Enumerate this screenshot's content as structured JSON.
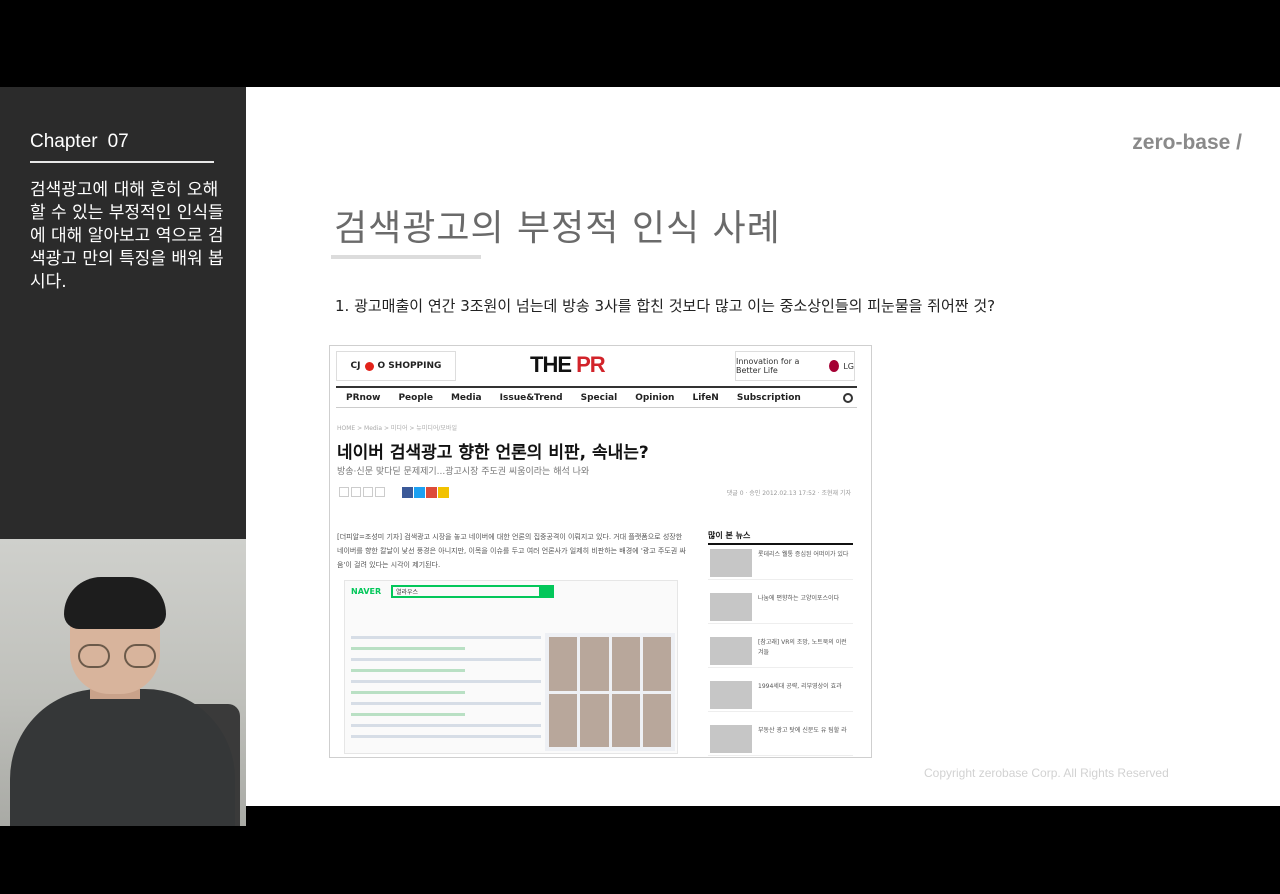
{
  "sidebar": {
    "chapter_label": "Chapter",
    "chapter_number": "07",
    "description": "검색광고에 대해 흔히 오해할 수 있는 부정적인 인식들에 대해 알아보고 역으로 검색광고 만의 특징을 배워 봅시다."
  },
  "slide": {
    "logo": "zero-base /",
    "title": "검색광고의 부정적 인식 사례",
    "point": "1. 광고매출이 연간 3조원이 넘는데 방송 3사를 합친 것보다 많고 이는 중소상인들의 피눈물을 쥐어짠 것?",
    "copyright": "Copyright zerobase Corp. All Rights Reserved"
  },
  "article": {
    "ad_left": "O SHOPPING",
    "ad_left_prefix": "CJ",
    "masthead_the": "THE ",
    "masthead_pr": "PR",
    "ad_right": "Innovation for a Better Life",
    "ad_right_brand": "LG",
    "nav": [
      "PRnow",
      "People",
      "Media",
      "Issue&Trend",
      "Special",
      "Opinion",
      "LifeN",
      "Subscription"
    ],
    "breadcrumb": "HOME > Media > 미디어 > 뉴미디어/모바일",
    "headline": "네이버 검색광고 향한 언론의 비판, 속내는?",
    "subheadline": "방송·신문 맞다딛 문제제기...광고시장 주도권 씨움이라는 해석 나와",
    "meta": "댓글 0 · 승인 2012.02.13 17:52 · 조현재 기자",
    "body": "[더피알=조성미 기자] 검색광고 시장을 놓고 네이버에 대한 언론의 집중공격이 이뤄지고 있다. 거대 플랫폼으로 성장한 네이버를 향한 칼날이 낯선 풍경은 아니지만, 이목을 이슈를 두고 여러 언론사가 일제히 비판하는 배경에 '광고 주도권 싸움'이 걸려 있다는 시각이 제기된다.",
    "naver_logo": "NAVER",
    "naver_query": "열라우스",
    "sidebar_title": "많이 본 뉴스",
    "popular": [
      "롯데리스 웰통 증심된 어떠이가 있다",
      "나눔에 편향하는 고양이포스이다",
      "[참고래] VR의 조망, 노트북의 이런 겨들",
      "1994세대 공략, 리부영상이 효과",
      "부동산 광고 탓에 신문도 유 팀할 라"
    ]
  }
}
